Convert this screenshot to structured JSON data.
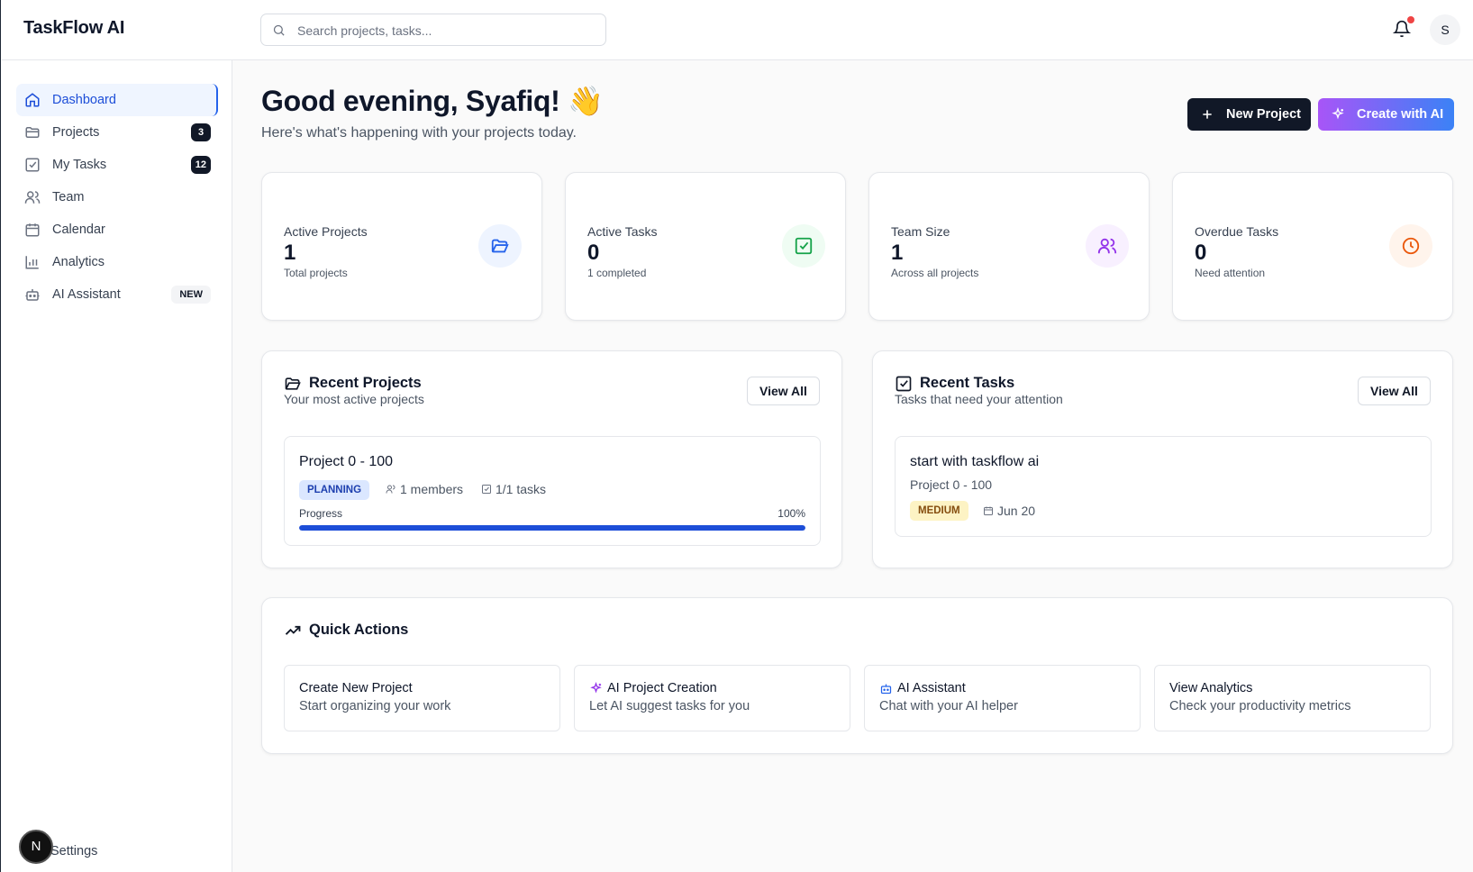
{
  "app": {
    "title": "TaskFlow AI"
  },
  "search": {
    "placeholder": "Search projects, tasks..."
  },
  "user": {
    "initial": "S"
  },
  "dev_badge": {
    "letter": "N"
  },
  "sidebar": {
    "items": [
      {
        "label": "Dashboard",
        "icon": "home-icon",
        "active": true
      },
      {
        "label": "Projects",
        "icon": "folder-icon",
        "badge": "3"
      },
      {
        "label": "My Tasks",
        "icon": "check-square-icon",
        "badge": "12"
      },
      {
        "label": "Team",
        "icon": "users-icon"
      },
      {
        "label": "Calendar",
        "icon": "calendar-icon"
      },
      {
        "label": "Analytics",
        "icon": "bar-chart-icon"
      },
      {
        "label": "AI Assistant",
        "icon": "bot-icon",
        "badge": "NEW"
      }
    ],
    "settings_label": "Settings"
  },
  "header": {
    "greeting": "Good evening, Syafiq! 👋",
    "subtitle": "Here's what's happening with your projects today.",
    "new_project_label": "New Project",
    "create_ai_label": "Create with AI"
  },
  "stats": [
    {
      "label": "Active Projects",
      "value": "1",
      "sub": "Total projects",
      "icon": "folder-open-icon",
      "color": "#2563eb",
      "bg": "#eef4ff"
    },
    {
      "label": "Active Tasks",
      "value": "0",
      "sub": "1 completed",
      "icon": "check-square-icon",
      "color": "#16a34a",
      "bg": "#effcf3"
    },
    {
      "label": "Team Size",
      "value": "1",
      "sub": "Across all projects",
      "icon": "users-icon",
      "color": "#9333ea",
      "bg": "#f8f0ff"
    },
    {
      "label": "Overdue Tasks",
      "value": "0",
      "sub": "Need attention",
      "icon": "clock-icon",
      "color": "#ea580c",
      "bg": "#fff4ec"
    }
  ],
  "recent_projects": {
    "title": "Recent Projects",
    "subtitle": "Your most active projects",
    "view_all": "View All",
    "items": [
      {
        "name": "Project 0 - 100",
        "status": "PLANNING",
        "members": "1 members",
        "tasks": "1/1 tasks",
        "progress_label": "Progress",
        "progress_text": "100%",
        "progress": 100
      }
    ]
  },
  "recent_tasks": {
    "title": "Recent Tasks",
    "subtitle": "Tasks that need your attention",
    "view_all": "View All",
    "items": [
      {
        "name": "start with taskflow ai",
        "project": "Project 0 - 100",
        "priority": "MEDIUM",
        "due": "Jun 20"
      }
    ]
  },
  "quick_actions": {
    "title": "Quick Actions",
    "items": [
      {
        "title": "Create New Project",
        "sub": "Start organizing your work"
      },
      {
        "title": "AI Project Creation",
        "sub": "Let AI suggest tasks for you",
        "icon": "sparkles-icon"
      },
      {
        "title": "AI Assistant",
        "sub": "Chat with your AI helper",
        "icon": "bot-icon"
      },
      {
        "title": "View Analytics",
        "sub": "Check your productivity metrics"
      }
    ]
  },
  "colors": {
    "accent": "#2563eb",
    "primary_dark": "#111827",
    "ai_gradient_start": "#a855f7",
    "ai_gradient_end": "#3b82f6",
    "notification": "#ef4444"
  }
}
